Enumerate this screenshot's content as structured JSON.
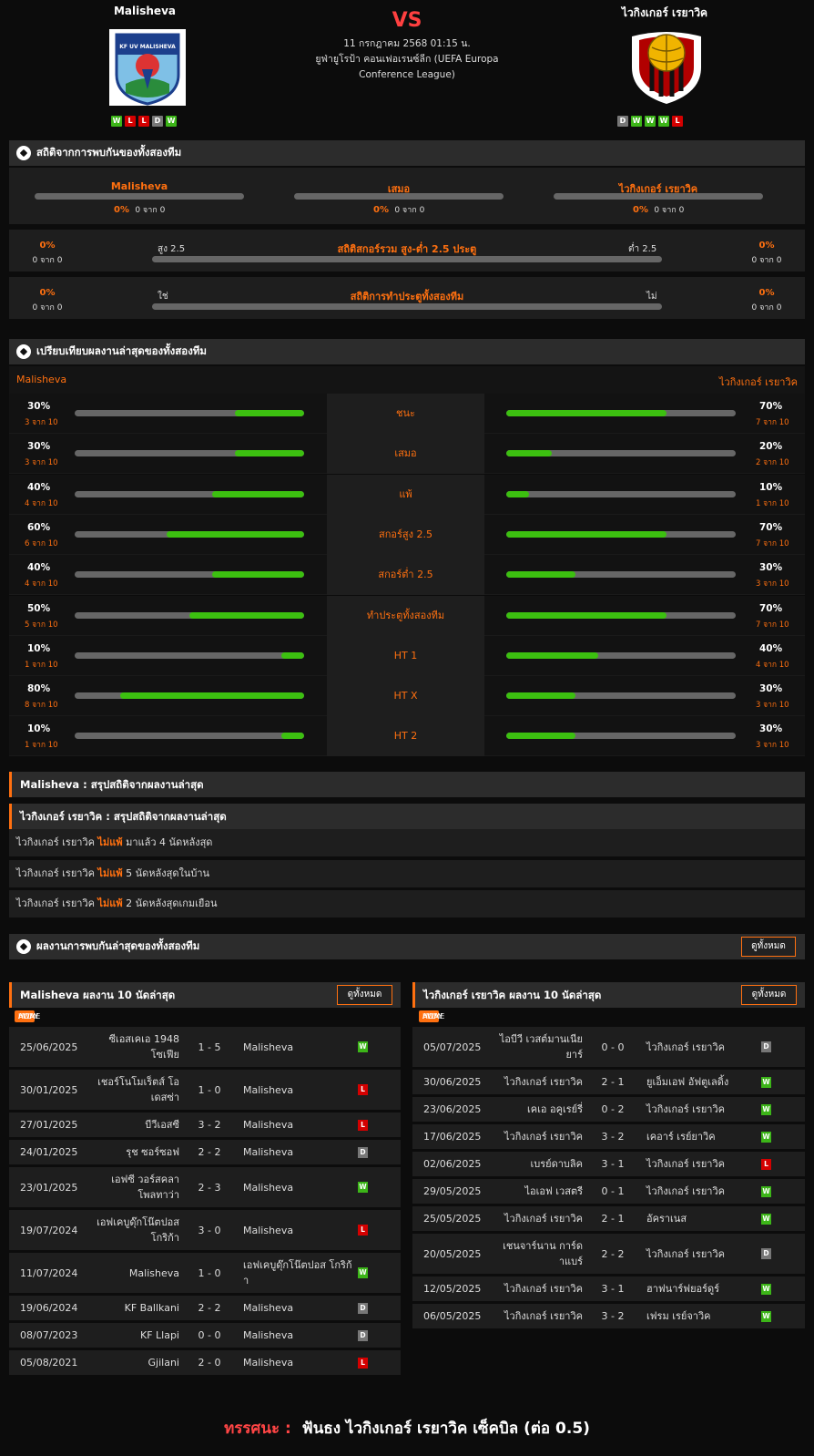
{
  "home": {
    "name": "Malisheva",
    "logo_text": "KF UV MALISHEVA",
    "form": [
      "W",
      "L",
      "L",
      "D",
      "W"
    ]
  },
  "away": {
    "name": "ไวกิงเกอร์ เรยาวิค",
    "form": [
      "D",
      "W",
      "W",
      "W",
      "L"
    ]
  },
  "vs": "VS",
  "match": {
    "datetime": "11 กรกฎาคม 2568 01:15 น.",
    "competition": "ยูฟ่ายูโรป้า คอนเฟอเรนซ์ลีก (UEFA Europa Conference League)"
  },
  "h2h": {
    "title": "สถิติจากการพบกันของทั้งสองทีม",
    "cols": [
      {
        "label": "Malisheva",
        "pct": "0%",
        "sub": "0 จาก 0"
      },
      {
        "label": "เสมอ",
        "pct": "0%",
        "sub": "0 จาก 0"
      },
      {
        "label": "ไวกิงเกอร์ เรยาวิค",
        "pct": "0%",
        "sub": "0 จาก 0"
      }
    ],
    "ou": {
      "title": "สถิติสกอร์รวม สูง-ต่ำ 2.5 ประตู",
      "left_label": "สูง 2.5",
      "right_label": "ต่ำ 2.5",
      "lpct": "0%",
      "lsub": "0 จาก 0",
      "rpct": "0%",
      "rsub": "0 จาก 0"
    },
    "btts": {
      "title": "สถิติการทำประตูทั้งสองทีม",
      "left_label": "ใช่",
      "right_label": "ไม่",
      "lpct": "0%",
      "lsub": "0 จาก 0",
      "rpct": "0%",
      "rsub": "0 จาก 0"
    }
  },
  "compare": {
    "title": "เปรียบเทียบผลงานล่าสุดของทั้งสองทีม",
    "home": "Malisheva",
    "away": "ไวกิงเกอร์ เรยาวิค",
    "rows": [
      {
        "label": "ชนะ",
        "hp": "30%",
        "hs": "3 จาก 10",
        "hv": 0.3,
        "ap": "70%",
        "as": "7 จาก 10",
        "av": 0.7
      },
      {
        "label": "เสมอ",
        "hp": "30%",
        "hs": "3 จาก 10",
        "hv": 0.3,
        "ap": "20%",
        "as": "2 จาก 10",
        "av": 0.2
      },
      {
        "label": "แพ้",
        "hp": "40%",
        "hs": "4 จาก 10",
        "hv": 0.4,
        "ap": "10%",
        "as": "1 จาก 10",
        "av": 0.1
      },
      {
        "label": "สกอร์สูง 2.5",
        "hp": "60%",
        "hs": "6 จาก 10",
        "hv": 0.6,
        "ap": "70%",
        "as": "7 จาก 10",
        "av": 0.7
      },
      {
        "label": "สกอร์ต่ำ 2.5",
        "hp": "40%",
        "hs": "4 จาก 10",
        "hv": 0.4,
        "ap": "30%",
        "as": "3 จาก 10",
        "av": 0.3
      },
      {
        "label": "ทำประตูทั้งสองทีม",
        "hp": "50%",
        "hs": "5 จาก 10",
        "hv": 0.5,
        "ap": "70%",
        "as": "7 จาก 10",
        "av": 0.7
      },
      {
        "label": "HT 1",
        "hp": "10%",
        "hs": "1 จาก 10",
        "hv": 0.1,
        "ap": "40%",
        "as": "4 จาก 10",
        "av": 0.4
      },
      {
        "label": "HT X",
        "hp": "80%",
        "hs": "8 จาก 10",
        "hv": 0.8,
        "ap": "30%",
        "as": "3 จาก 10",
        "av": 0.3
      },
      {
        "label": "HT 2",
        "hp": "10%",
        "hs": "1 จาก 10",
        "hv": 0.1,
        "ap": "30%",
        "as": "3 จาก 10",
        "av": 0.3
      }
    ]
  },
  "summary": {
    "home_title": "Malisheva : สรุปสถิติจากผลงานล่าสุด",
    "away_title": "ไวกิงเกอร์ เรยาวิค : สรุปสถิติจากผลงานล่าสุด",
    "lines": [
      {
        "team": "ไวกิงเกอร์ เรยาวิค",
        "kw": "ไม่แพ้",
        "rest": "มาแล้ว 4 นัดหลังสุด"
      },
      {
        "team": "ไวกิงเกอร์ เรยาวิค",
        "kw": "ไม่แพ้",
        "rest": "5 นัดหลังสุดในบ้าน"
      },
      {
        "team": "ไวกิงเกอร์ เรยาวิค",
        "kw": "ไม่แพ้",
        "rest": "2 นัดหลังสุดเกมเยือน"
      }
    ]
  },
  "recent": {
    "title": "ผลงานการพบกันล่าสุดของทั้งสองทีม",
    "view_all": "ดูทั้งหมด"
  },
  "tabs": [
    "ALL",
    "HOME",
    "AWAY"
  ],
  "home_last10": {
    "title": "Malisheva ผลงาน 10 นัดล่าสุด",
    "view_all": "ดูทั้งหมด",
    "rows": [
      {
        "date": "25/06/2025",
        "home": "ซีเอสเคเอ 1948 โซเฟีย",
        "score": "1 - 5",
        "away": "Malisheva",
        "res": "W",
        "tall": true
      },
      {
        "date": "30/01/2025",
        "home": "เชอร์โนโมเร็ตส์ โอเดสซ่า",
        "score": "1 - 0",
        "away": "Malisheva",
        "res": "L",
        "tall": true
      },
      {
        "date": "27/01/2025",
        "home": "บีวีเอสซี",
        "score": "3 - 2",
        "away": "Malisheva",
        "res": "L"
      },
      {
        "date": "24/01/2025",
        "home": "รุช ซอร์ซอฟ",
        "score": "2 - 2",
        "away": "Malisheva",
        "res": "D"
      },
      {
        "date": "23/01/2025",
        "home": "เอฟซี วอร์สคลา โพลทาว่า",
        "score": "2 - 3",
        "away": "Malisheva",
        "res": "W",
        "tall": true
      },
      {
        "date": "19/07/2024",
        "home": "เอฟเคบูดุ๊กโน๊ตปอส โกริก้า",
        "score": "3 - 0",
        "away": "Malisheva",
        "res": "L",
        "tall": true
      },
      {
        "date": "11/07/2024",
        "home": "Malisheva",
        "score": "1 - 0",
        "away": "เอฟเคบูดุ๊กโน๊ตปอส โกริก้า",
        "res": "W",
        "tall": true
      },
      {
        "date": "19/06/2024",
        "home": "KF Ballkani",
        "score": "2 - 2",
        "away": "Malisheva",
        "res": "D"
      },
      {
        "date": "08/07/2023",
        "home": "KF Llapi",
        "score": "0 - 0",
        "away": "Malisheva",
        "res": "D"
      },
      {
        "date": "05/08/2021",
        "home": "Gjilani",
        "score": "2 - 0",
        "away": "Malisheva",
        "res": "L"
      }
    ]
  },
  "away_last10": {
    "title": "ไวกิงเกอร์ เรยาวิค ผลงาน 10 นัดล่าสุด",
    "view_all": "ดูทั้งหมด",
    "rows": [
      {
        "date": "05/07/2025",
        "home": "ไอบีวี เวสต์มานเนียยาร์",
        "score": "0 - 0",
        "away": "ไวกิงเกอร์ เรยาวิค",
        "res": "D",
        "tall": true
      },
      {
        "date": "30/06/2025",
        "home": "ไวกิงเกอร์ เรยาวิค",
        "score": "2 - 1",
        "away": "ยูเอ็มเอฟ อัฟตูเลดิ้ง",
        "res": "W"
      },
      {
        "date": "23/06/2025",
        "home": "เคเอ อคูเรย์รี่",
        "score": "0 - 2",
        "away": "ไวกิงเกอร์ เรยาวิค",
        "res": "W"
      },
      {
        "date": "17/06/2025",
        "home": "ไวกิงเกอร์ เรยาวิค",
        "score": "3 - 2",
        "away": "เคอาร์ เรย์ยาวิค",
        "res": "W"
      },
      {
        "date": "02/06/2025",
        "home": "เบรย์ดาบลิค",
        "score": "3 - 1",
        "away": "ไวกิงเกอร์ เรยาวิค",
        "res": "L"
      },
      {
        "date": "29/05/2025",
        "home": "ไอเอฟ เวสตรี",
        "score": "0 - 1",
        "away": "ไวกิงเกอร์ เรยาวิค",
        "res": "W"
      },
      {
        "date": "25/05/2025",
        "home": "ไวกิงเกอร์ เรยาวิค",
        "score": "2 - 1",
        "away": "อัคราเนส",
        "res": "W"
      },
      {
        "date": "20/05/2025",
        "home": "เชนจาร์นาน การ์ดาแบร์",
        "score": "2 - 2",
        "away": "ไวกิงเกอร์ เรยาวิค",
        "res": "D",
        "tall": true
      },
      {
        "date": "12/05/2025",
        "home": "ไวกิงเกอร์ เรยาวิค",
        "score": "3 - 1",
        "away": "ฮาฟนาร์ฟยอร์ดูร์",
        "res": "W"
      },
      {
        "date": "06/05/2025",
        "home": "ไวกิงเกอร์ เรยาวิค",
        "score": "3 - 2",
        "away": "เฟรม เรย์จาวิค",
        "res": "W"
      }
    ]
  },
  "prediction": {
    "label": "ทรรศนะ :",
    "text": "ฟันธง ไวกิงเกอร์ เรยาวิค เซ็คบิล (ต่อ 0.5)"
  }
}
